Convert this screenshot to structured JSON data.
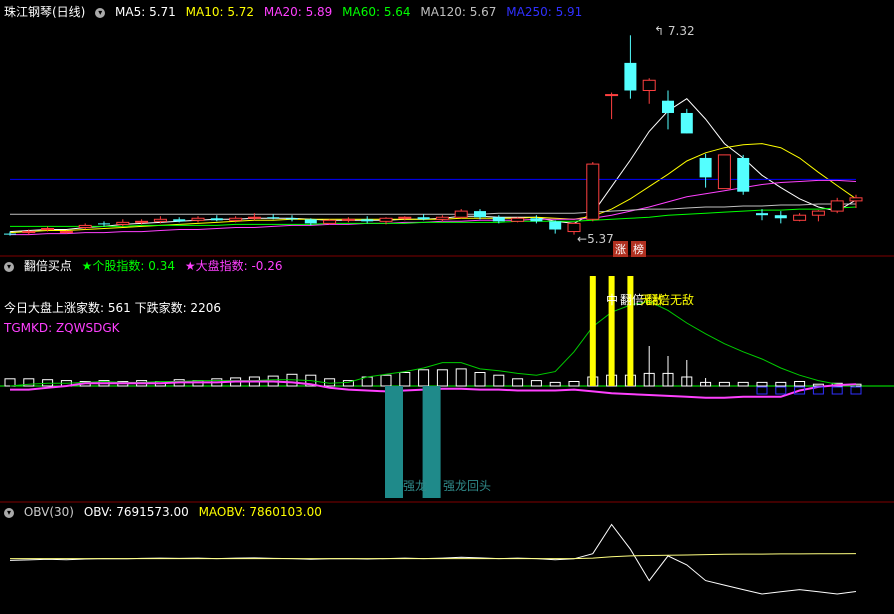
{
  "colors": {
    "up": "#ff4040",
    "down": "#54ffff",
    "ma5": "#ffffff",
    "ma10": "#ffff00",
    "ma20": "#ff40ff",
    "ma60": "#00ff00",
    "ma120": "#c0c0c0",
    "ma250": "#0000ff",
    "divider": "#800000",
    "obv": "#ffffff",
    "maobv": "#ffff80"
  },
  "panel1": {
    "title": "珠江钢琴(日线)",
    "ma_labels": [
      "MA5: 5.71",
      "MA10: 5.72",
      "MA20: 5.89",
      "MA60: 5.64",
      "MA120: 5.67",
      "MA250: 5.91"
    ],
    "high_label": "7.32",
    "low_label": "5.37",
    "badges": [
      "涨",
      "榜"
    ]
  },
  "panel2": {
    "title": "翻倍买点",
    "stock_index_label": "★个股指数: 0.34",
    "market_index_label": "★大盘指数: -0.26",
    "market_breadth": "今日大盘上涨家数: 561 下跌家数: 2206",
    "tgmkd": "TGMKD: ZQWSDGK",
    "signals": [
      "中",
      "翻倍",
      "无敌",
      "翻倍无敌"
    ],
    "dragon_labels": [
      "强龙",
      "强龙回头"
    ]
  },
  "panel3": {
    "title": "OBV(30)",
    "obv_label": "OBV: 7691573.00",
    "maobv_label": "MAOBV: 7860103.00"
  },
  "chart_data": [
    {
      "type": "candlestick",
      "title": "珠江钢琴(日线)",
      "ylim": [
        5.2,
        7.45
      ],
      "series": [
        {
          "name": "K",
          "ohlc": [
            [
              5.38,
              5.4,
              5.36,
              5.37
            ],
            [
              5.39,
              5.42,
              5.37,
              5.4
            ],
            [
              5.42,
              5.45,
              5.4,
              5.43
            ],
            [
              5.4,
              5.41,
              5.38,
              5.4
            ],
            [
              5.44,
              5.48,
              5.42,
              5.46
            ],
            [
              5.48,
              5.5,
              5.45,
              5.47
            ],
            [
              5.47,
              5.52,
              5.45,
              5.49
            ],
            [
              5.5,
              5.52,
              5.47,
              5.5
            ],
            [
              5.5,
              5.55,
              5.48,
              5.52
            ],
            [
              5.52,
              5.54,
              5.49,
              5.5
            ],
            [
              5.51,
              5.55,
              5.49,
              5.53
            ],
            [
              5.53,
              5.56,
              5.5,
              5.51
            ],
            [
              5.51,
              5.55,
              5.49,
              5.53
            ],
            [
              5.53,
              5.58,
              5.51,
              5.54
            ],
            [
              5.54,
              5.57,
              5.52,
              5.53
            ],
            [
              5.53,
              5.56,
              5.5,
              5.52
            ],
            [
              5.52,
              5.53,
              5.46,
              5.48
            ],
            [
              5.48,
              5.52,
              5.47,
              5.51
            ],
            [
              5.51,
              5.54,
              5.49,
              5.52
            ],
            [
              5.52,
              5.55,
              5.48,
              5.5
            ],
            [
              5.5,
              5.54,
              5.47,
              5.53
            ],
            [
              5.53,
              5.55,
              5.51,
              5.54
            ],
            [
              5.54,
              5.57,
              5.51,
              5.52
            ],
            [
              5.52,
              5.56,
              5.5,
              5.54
            ],
            [
              5.54,
              5.62,
              5.53,
              5.6
            ],
            [
              5.6,
              5.62,
              5.52,
              5.54
            ],
            [
              5.54,
              5.56,
              5.48,
              5.5
            ],
            [
              5.5,
              5.54,
              5.49,
              5.53
            ],
            [
              5.53,
              5.56,
              5.48,
              5.5
            ],
            [
              5.5,
              5.51,
              5.38,
              5.42
            ],
            [
              5.4,
              5.49,
              5.37,
              5.48
            ],
            [
              5.52,
              6.08,
              5.5,
              6.06
            ],
            [
              6.74,
              6.76,
              6.5,
              6.74
            ],
            [
              7.05,
              7.32,
              6.7,
              6.78
            ],
            [
              6.78,
              6.9,
              6.65,
              6.88
            ],
            [
              6.68,
              6.78,
              6.4,
              6.56
            ],
            [
              6.56,
              6.6,
              6.36,
              6.36
            ],
            [
              6.12,
              6.16,
              5.83,
              5.93
            ],
            [
              5.82,
              6.15,
              5.82,
              6.15
            ],
            [
              6.12,
              6.15,
              5.76,
              5.79
            ],
            [
              5.58,
              5.62,
              5.51,
              5.56
            ],
            [
              5.56,
              5.6,
              5.48,
              5.53
            ],
            [
              5.51,
              5.58,
              5.5,
              5.56
            ],
            [
              5.56,
              5.61,
              5.5,
              5.6
            ],
            [
              5.6,
              5.73,
              5.58,
              5.7
            ],
            [
              5.7,
              5.76,
              5.63,
              5.73
            ]
          ]
        },
        {
          "name": "MA5",
          "values": [
            5.4,
            5.41,
            5.42,
            5.42,
            5.44,
            5.45,
            5.47,
            5.48,
            5.49,
            5.5,
            5.51,
            5.52,
            5.52,
            5.53,
            5.53,
            5.53,
            5.52,
            5.51,
            5.51,
            5.51,
            5.51,
            5.52,
            5.52,
            5.53,
            5.55,
            5.55,
            5.54,
            5.54,
            5.54,
            5.5,
            5.48,
            5.58,
            5.84,
            6.1,
            6.38,
            6.58,
            6.7,
            6.5,
            6.26,
            6.12,
            5.95,
            5.83,
            5.72,
            5.64,
            5.6,
            5.71
          ]
        },
        {
          "name": "MA10",
          "values": [
            5.39,
            5.4,
            5.41,
            5.41,
            5.42,
            5.43,
            5.44,
            5.45,
            5.46,
            5.47,
            5.48,
            5.49,
            5.5,
            5.51,
            5.51,
            5.52,
            5.52,
            5.52,
            5.52,
            5.52,
            5.52,
            5.52,
            5.52,
            5.52,
            5.53,
            5.53,
            5.53,
            5.53,
            5.54,
            5.53,
            5.52,
            5.55,
            5.62,
            5.72,
            5.84,
            5.96,
            6.09,
            6.17,
            6.22,
            6.25,
            6.26,
            6.22,
            6.12,
            5.98,
            5.85,
            5.72
          ]
        },
        {
          "name": "MA20",
          "values": [
            5.37,
            5.37,
            5.38,
            5.38,
            5.39,
            5.39,
            5.4,
            5.4,
            5.41,
            5.42,
            5.42,
            5.43,
            5.44,
            5.44,
            5.45,
            5.46,
            5.46,
            5.47,
            5.47,
            5.48,
            5.48,
            5.49,
            5.49,
            5.5,
            5.5,
            5.51,
            5.51,
            5.51,
            5.52,
            5.52,
            5.52,
            5.53,
            5.56,
            5.6,
            5.64,
            5.69,
            5.74,
            5.77,
            5.8,
            5.83,
            5.86,
            5.88,
            5.89,
            5.9,
            5.9,
            5.89
          ]
        },
        {
          "name": "MA60",
          "values": [
            5.45,
            5.45,
            5.45,
            5.45,
            5.45,
            5.45,
            5.45,
            5.46,
            5.46,
            5.46,
            5.46,
            5.46,
            5.47,
            5.47,
            5.47,
            5.47,
            5.47,
            5.48,
            5.48,
            5.48,
            5.48,
            5.48,
            5.49,
            5.49,
            5.49,
            5.49,
            5.49,
            5.5,
            5.5,
            5.5,
            5.5,
            5.51,
            5.52,
            5.53,
            5.54,
            5.56,
            5.57,
            5.58,
            5.59,
            5.6,
            5.61,
            5.61,
            5.62,
            5.62,
            5.63,
            5.64
          ]
        },
        {
          "name": "MA120",
          "values": [
            5.57,
            5.57,
            5.57,
            5.57,
            5.57,
            5.57,
            5.57,
            5.57,
            5.57,
            5.57,
            5.57,
            5.57,
            5.57,
            5.57,
            5.57,
            5.57,
            5.57,
            5.57,
            5.57,
            5.57,
            5.57,
            5.57,
            5.57,
            5.57,
            5.57,
            5.57,
            5.58,
            5.58,
            5.58,
            5.58,
            5.58,
            5.59,
            5.6,
            5.61,
            5.62,
            5.62,
            5.63,
            5.64,
            5.64,
            5.65,
            5.65,
            5.66,
            5.66,
            5.67,
            5.67,
            5.67
          ]
        },
        {
          "name": "MA250",
          "values": [
            5.91,
            5.91,
            5.91,
            5.91,
            5.91,
            5.91,
            5.91,
            5.91,
            5.91,
            5.91,
            5.91,
            5.91,
            5.91,
            5.91,
            5.91,
            5.91,
            5.91,
            5.91,
            5.91,
            5.91,
            5.91,
            5.91,
            5.91,
            5.91,
            5.91,
            5.91,
            5.91,
            5.91,
            5.91,
            5.91,
            5.91,
            5.91,
            5.91,
            5.91,
            5.91,
            5.91,
            5.91,
            5.91,
            5.91,
            5.91,
            5.91,
            5.91,
            5.91,
            5.91,
            5.91,
            5.91
          ]
        }
      ]
    },
    {
      "type": "bar",
      "title": "翻倍买点",
      "ylim": [
        -1.4,
        1.4
      ],
      "series": [
        {
          "name": "hollow_bars",
          "values": [
            0.08,
            0.08,
            0.07,
            0.06,
            0.05,
            0.06,
            0.05,
            0.06,
            0.05,
            0.07,
            0.06,
            0.08,
            0.09,
            0.1,
            0.11,
            0.13,
            0.12,
            0.08,
            0.06,
            0.1,
            0.12,
            0.15,
            0.18,
            0.18,
            0.19,
            0.15,
            0.12,
            0.08,
            0.06,
            0.04,
            0.05,
            0.1,
            0.12,
            0.12,
            0.14,
            0.14,
            0.1,
            0.04,
            0.04,
            0.04,
            0.04,
            0.04,
            0.05,
            0.02,
            0.03,
            0.02
          ]
        },
        {
          "name": "green_line",
          "values": [
            0.0,
            0.02,
            0.03,
            0.03,
            0.04,
            0.05,
            0.04,
            0.04,
            0.05,
            0.05,
            0.06,
            0.06,
            0.06,
            0.06,
            0.07,
            0.07,
            0.06,
            0.03,
            0.04,
            0.1,
            0.13,
            0.16,
            0.2,
            0.26,
            0.26,
            0.19,
            0.17,
            0.14,
            0.12,
            0.16,
            0.38,
            0.66,
            0.82,
            0.9,
            0.94,
            0.84,
            0.7,
            0.58,
            0.47,
            0.38,
            0.3,
            0.2,
            0.12,
            0.06,
            0.02,
            0.0
          ]
        },
        {
          "name": "magenta_line",
          "values": [
            -0.04,
            -0.04,
            -0.02,
            0.0,
            0.03,
            0.03,
            0.03,
            0.03,
            0.03,
            0.04,
            0.04,
            0.04,
            0.05,
            0.05,
            0.05,
            0.04,
            0.02,
            -0.02,
            -0.04,
            -0.05,
            -0.06,
            -0.05,
            -0.04,
            -0.03,
            -0.03,
            -0.04,
            -0.04,
            -0.05,
            -0.05,
            -0.05,
            -0.04,
            -0.06,
            -0.08,
            -0.09,
            -0.1,
            -0.11,
            -0.12,
            -0.13,
            -0.13,
            -0.12,
            -0.12,
            -0.12,
            -0.05,
            -0.01,
            0.01,
            0.02
          ]
        }
      ]
    },
    {
      "type": "line",
      "title": "OBV(30)",
      "series": [
        {
          "name": "OBV",
          "values": [
            7830000,
            7832000,
            7835000,
            7833000,
            7836000,
            7838000,
            7837000,
            7839000,
            7840000,
            7839000,
            7840000,
            7838000,
            7840000,
            7841000,
            7839000,
            7838000,
            7835000,
            7837000,
            7838000,
            7836000,
            7838000,
            7840000,
            7838000,
            7840000,
            7844000,
            7841000,
            7838000,
            7840000,
            7838000,
            7833000,
            7837000,
            7860000,
            7990000,
            7880000,
            7740000,
            7850000,
            7810000,
            7740000,
            7720000,
            7700000,
            7680000,
            7690000,
            7700000,
            7690000,
            7680000,
            7691573
          ]
        },
        {
          "name": "MAOBV",
          "values": [
            7838000,
            7838000,
            7838000,
            7838000,
            7838000,
            7838000,
            7838000,
            7838000,
            7838000,
            7838000,
            7838000,
            7838000,
            7838000,
            7838000,
            7838000,
            7838000,
            7838000,
            7838000,
            7838000,
            7838000,
            7838000,
            7838000,
            7838000,
            7838000,
            7838000,
            7838000,
            7838000,
            7838000,
            7838000,
            7838000,
            7838000,
            7840000,
            7846000,
            7850000,
            7852000,
            7853000,
            7854000,
            7856000,
            7857000,
            7858000,
            7858000,
            7859000,
            7859000,
            7860000,
            7860000,
            7860103
          ]
        }
      ]
    }
  ]
}
